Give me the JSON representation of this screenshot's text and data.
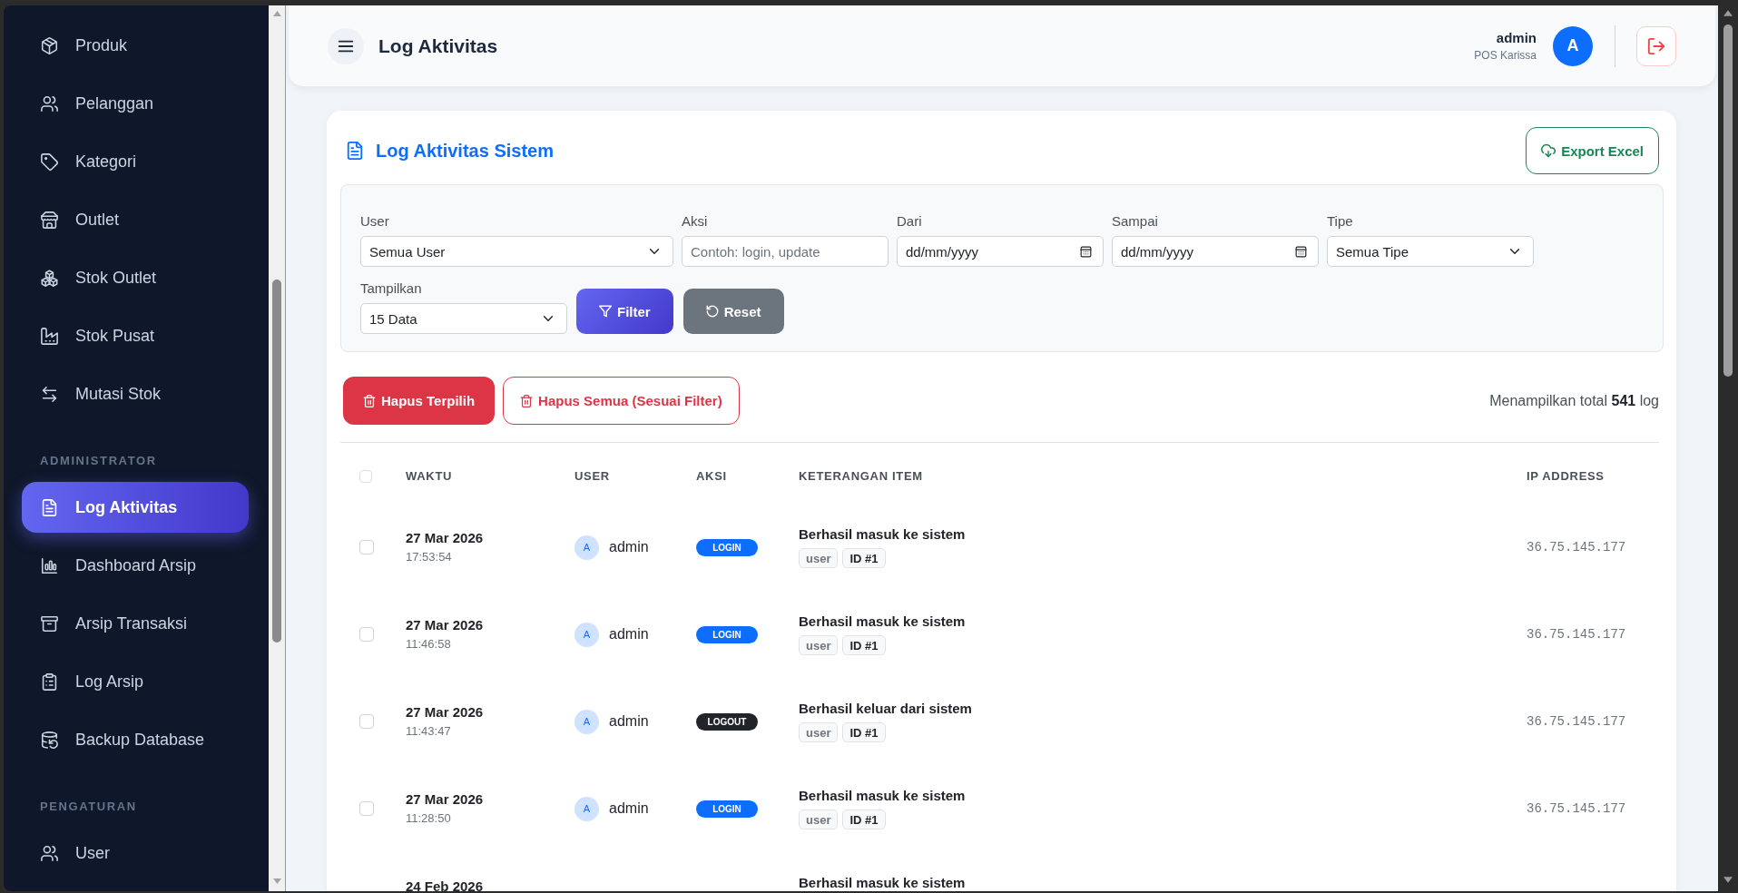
{
  "sidebar": {
    "sections": [
      {
        "items": [
          {
            "label": "Produk",
            "selected": false
          },
          {
            "label": "Pelanggan",
            "selected": false
          },
          {
            "label": "Kategori",
            "selected": false
          },
          {
            "label": "Outlet",
            "selected": false
          },
          {
            "label": "Stok Outlet",
            "selected": false
          },
          {
            "label": "Stok Pusat",
            "selected": false
          },
          {
            "label": "Mutasi Stok",
            "selected": false
          }
        ]
      },
      {
        "heading": "ADMINISTRATOR",
        "items": [
          {
            "label": "Log Aktivitas",
            "selected": true
          },
          {
            "label": "Dashboard Arsip",
            "selected": false
          },
          {
            "label": "Arsip Transaksi",
            "selected": false
          },
          {
            "label": "Log Arsip",
            "selected": false
          },
          {
            "label": "Backup Database",
            "selected": false
          }
        ]
      },
      {
        "heading": "PENGATURAN",
        "items": [
          {
            "label": "User",
            "selected": false
          }
        ]
      }
    ]
  },
  "header": {
    "title": "Log Aktivitas",
    "user_name": "admin",
    "store_name": "POS Karissa",
    "avatar_initial": "A"
  },
  "card": {
    "title": "Log Aktivitas Sistem",
    "export_button": "Export Excel",
    "filters": [
      {
        "kind": "select",
        "label": "User",
        "value": "Semua User"
      },
      {
        "kind": "text",
        "label": "Aksi",
        "placeholder": "Contoh: login, update"
      },
      {
        "kind": "date",
        "label": "Dari",
        "value": "dd/mm/yyyy"
      },
      {
        "kind": "date",
        "label": "Sampai",
        "value": "dd/mm/yyyy"
      },
      {
        "kind": "select",
        "label": "Tipe",
        "value": "Semua Tipe"
      },
      {
        "kind": "select",
        "label": "Tampilkan",
        "value": "15 Data"
      }
    ],
    "filter_buttons": [
      {
        "kind": "filter",
        "label": "Filter"
      },
      {
        "kind": "reset",
        "label": "Reset"
      }
    ],
    "bulk_buttons": [
      {
        "kind": "solid",
        "label": "Hapus Terpilih"
      },
      {
        "kind": "outline",
        "label": "Hapus Semua (Sesuai Filter)"
      }
    ],
    "summary": "Menampilkan total **541** log"
  },
  "table": {
    "select_all": {
      "checked": false
    },
    "columns": [
      "WAKTU",
      "USER",
      "AKSI",
      "KETERANGAN ITEM",
      "IP ADDRESS"
    ],
    "rows": [
      {
        "checked": false,
        "date": "27 Mar 2026",
        "time": "17:53:54",
        "user": {
          "initial": "A",
          "name": "admin"
        },
        "action": {
          "kind": "login",
          "label": "LOGIN"
        },
        "description": "Berhasil masuk ke sistem",
        "tags": [
          {
            "kind": "type",
            "text": "user"
          },
          {
            "kind": "id",
            "text": "ID #1"
          }
        ],
        "ip": "36.75.145.177"
      },
      {
        "checked": false,
        "date": "27 Mar 2026",
        "time": "11:46:58",
        "user": {
          "initial": "A",
          "name": "admin"
        },
        "action": {
          "kind": "login",
          "label": "LOGIN"
        },
        "description": "Berhasil masuk ke sistem",
        "tags": [
          {
            "kind": "type",
            "text": "user"
          },
          {
            "kind": "id",
            "text": "ID #1"
          }
        ],
        "ip": "36.75.145.177"
      },
      {
        "checked": false,
        "date": "27 Mar 2026",
        "time": "11:43:47",
        "user": {
          "initial": "A",
          "name": "admin"
        },
        "action": {
          "kind": "logout",
          "label": "LOGOUT"
        },
        "description": "Berhasil keluar dari sistem",
        "tags": [
          {
            "kind": "type",
            "text": "user"
          },
          {
            "kind": "id",
            "text": "ID #1"
          }
        ],
        "ip": "36.75.145.177"
      },
      {
        "checked": false,
        "date": "27 Mar 2026",
        "time": "11:28:50",
        "user": {
          "initial": "A",
          "name": "admin"
        },
        "action": {
          "kind": "login",
          "label": "LOGIN"
        },
        "description": "Berhasil masuk ke sistem",
        "tags": [
          {
            "kind": "type",
            "text": "user"
          },
          {
            "kind": "id",
            "text": "ID #1"
          }
        ],
        "ip": "36.75.145.177"
      },
      {
        "date": "24 Feb 2026",
        "description": "Berhasil masuk ke sistem"
      }
    ]
  }
}
